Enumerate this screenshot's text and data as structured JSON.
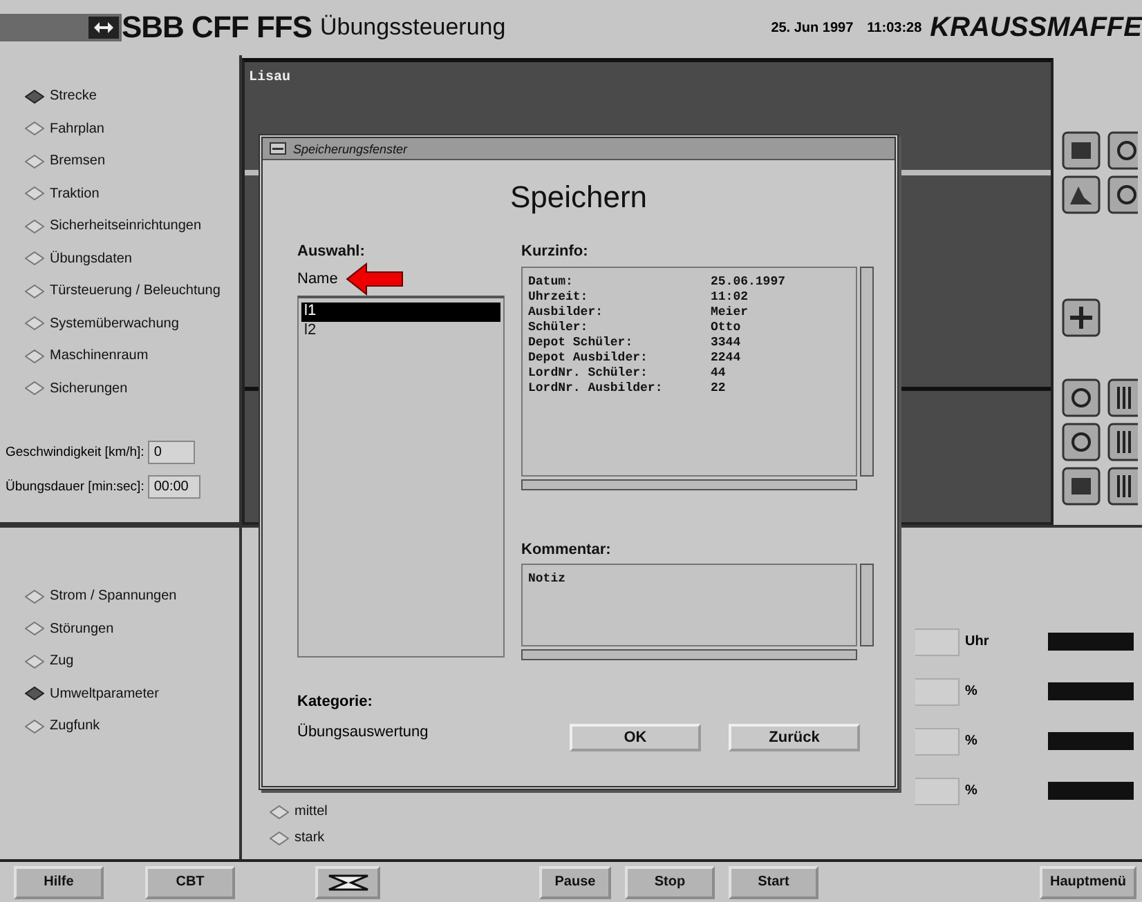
{
  "header": {
    "logo_text": "SBB CFF FFS",
    "title": "Übungssteuerung",
    "date": "25. Jun 1997",
    "time": "11:03:28",
    "brand": "KRAUSSMAFFE"
  },
  "left_menu": [
    {
      "label": "Strecke",
      "selected": true
    },
    {
      "label": "Fahrplan",
      "selected": false
    },
    {
      "label": "Bremsen",
      "selected": false
    },
    {
      "label": "Traktion",
      "selected": false
    },
    {
      "label": "Sicherheitseinrichtungen",
      "selected": false
    },
    {
      "label": "Übungsdaten",
      "selected": false
    },
    {
      "label": "Türsteuerung / Beleuchtung",
      "selected": false
    },
    {
      "label": "Systemüberwachung",
      "selected": false
    },
    {
      "label": "Maschinenraum",
      "selected": false
    },
    {
      "label": "Sicherungen",
      "selected": false
    }
  ],
  "fields": [
    {
      "label": "Geschwindigkeit [km/h]:",
      "value": "0"
    },
    {
      "label": "Übungsdauer [min:sec]:",
      "value": "00:00"
    }
  ],
  "track_view": {
    "title": "Lisau"
  },
  "lower_menu": [
    {
      "label": "Strom / Spannungen",
      "selected": false
    },
    {
      "label": "Störungen",
      "selected": false
    },
    {
      "label": "Zug",
      "selected": false
    },
    {
      "label": "Umweltparameter",
      "selected": true
    },
    {
      "label": "Zugfunk",
      "selected": false
    }
  ],
  "intensity_options": [
    {
      "label": "mittel",
      "selected": false
    },
    {
      "label": "stark",
      "selected": false
    }
  ],
  "readouts": [
    {
      "unit": "Uhr"
    },
    {
      "unit": "%"
    },
    {
      "unit": "%"
    },
    {
      "unit": "%"
    }
  ],
  "dialog": {
    "title": "Speicherungsfenster",
    "heading": "Speichern",
    "selection_label": "Auswahl:",
    "column_header": "Name",
    "items": [
      {
        "label": "l1",
        "selected": true
      },
      {
        "label": "l2",
        "selected": false
      }
    ],
    "info_label": "Kurzinfo:",
    "info": [
      {
        "label": "Datum:",
        "value": "25.06.1997"
      },
      {
        "label": "Uhrzeit:",
        "value": "11:02"
      },
      {
        "label": "Ausbilder:",
        "value": "Meier"
      },
      {
        "label": "Schüler:",
        "value": "Otto"
      },
      {
        "label": "Depot Schüler:",
        "value": "3344"
      },
      {
        "label": "Depot Ausbilder:",
        "value": "2244"
      },
      {
        "label": "LordNr. Schüler:",
        "value": "44"
      },
      {
        "label": "LordNr. Ausbilder:",
        "value": "22"
      }
    ],
    "comment_label": "Kommentar:",
    "comment": "Notiz",
    "category_label": "Kategorie:",
    "category": "Übungsauswertung",
    "buttons": [
      "OK",
      "Zurück"
    ]
  },
  "bottom_bar": [
    {
      "kind": "text",
      "label": "Hilfe"
    },
    {
      "kind": "text",
      "label": "CBT"
    },
    {
      "kind": "icon"
    },
    {
      "kind": "text",
      "label": "Pause"
    },
    {
      "kind": "text",
      "label": "Stop"
    },
    {
      "kind": "text",
      "label": "Start"
    },
    {
      "kind": "text",
      "label": "Hauptmenü"
    }
  ]
}
